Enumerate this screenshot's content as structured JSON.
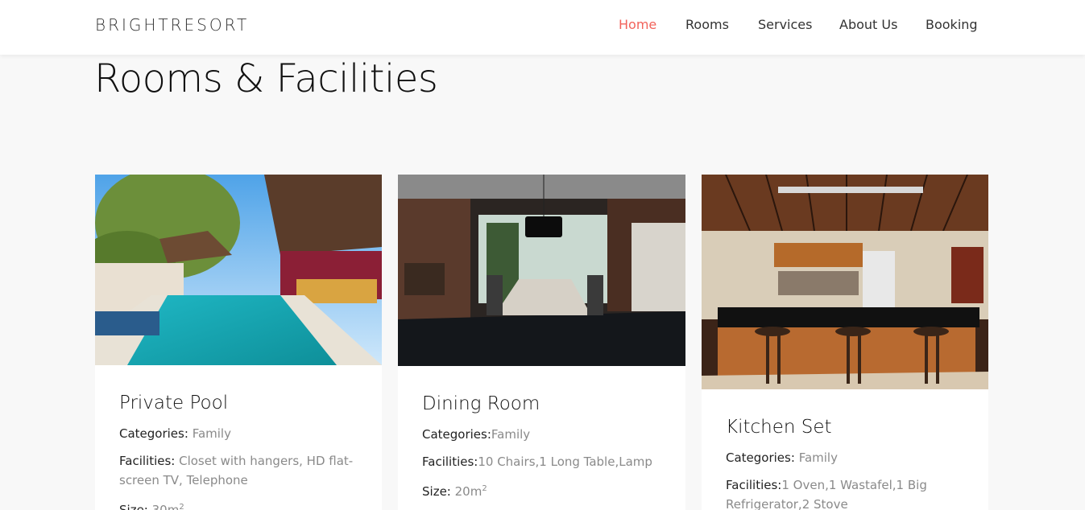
{
  "nav": {
    "brand": "BRIGHTRESORT",
    "items": [
      {
        "label": "Home",
        "active": true
      },
      {
        "label": "Rooms"
      },
      {
        "label": "Services"
      },
      {
        "label": "About Us"
      },
      {
        "label": "Booking"
      }
    ]
  },
  "page": {
    "title": "Rooms & Facilities"
  },
  "rooms": [
    {
      "name": "Private Pool",
      "categories_label": "Categories: ",
      "categories": "Family",
      "facilities_label": "Facilities: ",
      "facilities": "Closet with hangers, HD flat-screen TV, Telephone",
      "size_label": "Size: ",
      "size": "30m",
      "size_sup": "2"
    },
    {
      "name": "Dining Room",
      "categories_label": "Categories:",
      "categories": "Family",
      "facilities_label": "Facilities:",
      "facilities": "10 Chairs,1 Long Table,Lamp",
      "size_label": "Size: ",
      "size": "20m",
      "size_sup": "2"
    },
    {
      "name": "Kitchen Set",
      "categories_label": "Categories: ",
      "categories": "Family",
      "facilities_label": "Facilities:",
      "facilities": "1 Oven,1 Wastafel,1 Big Refrigerator,2 Stove"
    }
  ]
}
